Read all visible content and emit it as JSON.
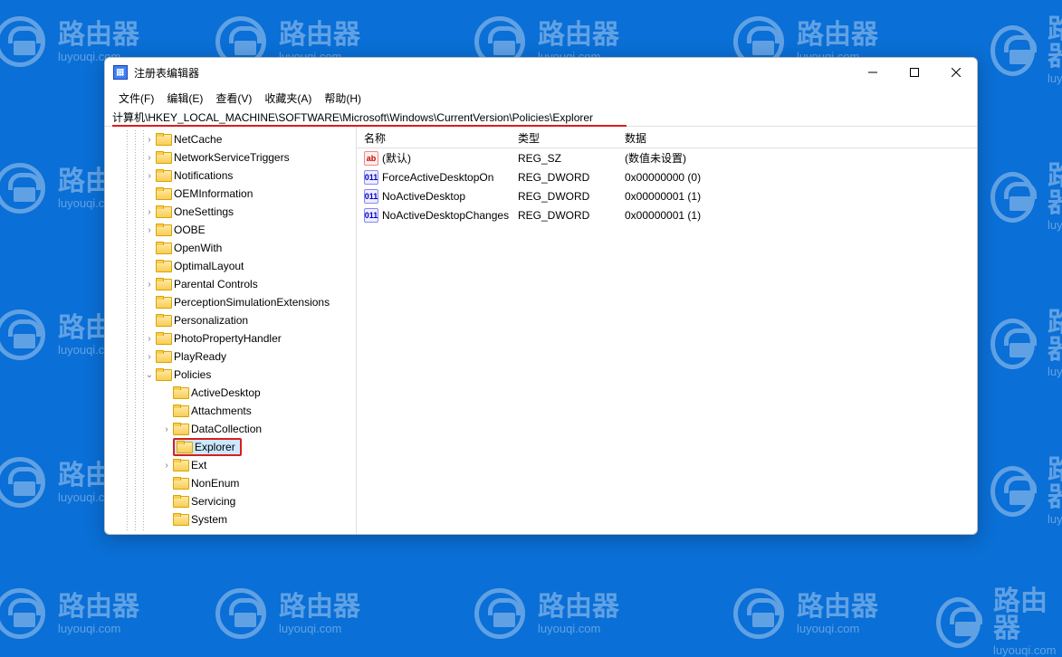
{
  "watermark": {
    "cn": "路由器",
    "en": "luyouqi.com"
  },
  "window": {
    "title": "注册表编辑器",
    "menu": {
      "file": "文件(F)",
      "edit": "编辑(E)",
      "view": "查看(V)",
      "favorites": "收藏夹(A)",
      "help": "帮助(H)"
    },
    "address": "计算机\\HKEY_LOCAL_MACHINE\\SOFTWARE\\Microsoft\\Windows\\CurrentVersion\\Policies\\Explorer"
  },
  "tree": {
    "selected": "Explorer",
    "items": [
      {
        "depth": 1,
        "label": "NetCache",
        "chevron": ">"
      },
      {
        "depth": 1,
        "label": "NetworkServiceTriggers",
        "chevron": ">"
      },
      {
        "depth": 1,
        "label": "Notifications",
        "chevron": ">"
      },
      {
        "depth": 1,
        "label": "OEMInformation",
        "chevron": ""
      },
      {
        "depth": 1,
        "label": "OneSettings",
        "chevron": ">"
      },
      {
        "depth": 1,
        "label": "OOBE",
        "chevron": ">"
      },
      {
        "depth": 1,
        "label": "OpenWith",
        "chevron": ""
      },
      {
        "depth": 1,
        "label": "OptimalLayout",
        "chevron": ""
      },
      {
        "depth": 1,
        "label": "Parental Controls",
        "chevron": ">"
      },
      {
        "depth": 1,
        "label": "PerceptionSimulationExtensions",
        "chevron": ""
      },
      {
        "depth": 1,
        "label": "Personalization",
        "chevron": ""
      },
      {
        "depth": 1,
        "label": "PhotoPropertyHandler",
        "chevron": ">"
      },
      {
        "depth": 1,
        "label": "PlayReady",
        "chevron": ">"
      },
      {
        "depth": 1,
        "label": "Policies",
        "chevron": "v"
      },
      {
        "depth": 2,
        "label": "ActiveDesktop",
        "chevron": ""
      },
      {
        "depth": 2,
        "label": "Attachments",
        "chevron": ""
      },
      {
        "depth": 2,
        "label": "DataCollection",
        "chevron": ">"
      },
      {
        "depth": 2,
        "label": "Explorer",
        "chevron": "",
        "selected": true
      },
      {
        "depth": 2,
        "label": "Ext",
        "chevron": ">"
      },
      {
        "depth": 2,
        "label": "NonEnum",
        "chevron": ""
      },
      {
        "depth": 2,
        "label": "Servicing",
        "chevron": ""
      },
      {
        "depth": 2,
        "label": "System",
        "chevron": ""
      }
    ]
  },
  "values": {
    "headers": {
      "name": "名称",
      "type": "类型",
      "data": "数据"
    },
    "rows": [
      {
        "icon": "sz",
        "name": "(默认)",
        "type": "REG_SZ",
        "data": "(数值未设置)"
      },
      {
        "icon": "dw",
        "name": "ForceActiveDesktopOn",
        "type": "REG_DWORD",
        "data": "0x00000000 (0)"
      },
      {
        "icon": "dw",
        "name": "NoActiveDesktop",
        "type": "REG_DWORD",
        "data": "0x00000001 (1)"
      },
      {
        "icon": "dw",
        "name": "NoActiveDesktopChanges",
        "type": "REG_DWORD",
        "data": "0x00000001 (1)"
      }
    ]
  }
}
